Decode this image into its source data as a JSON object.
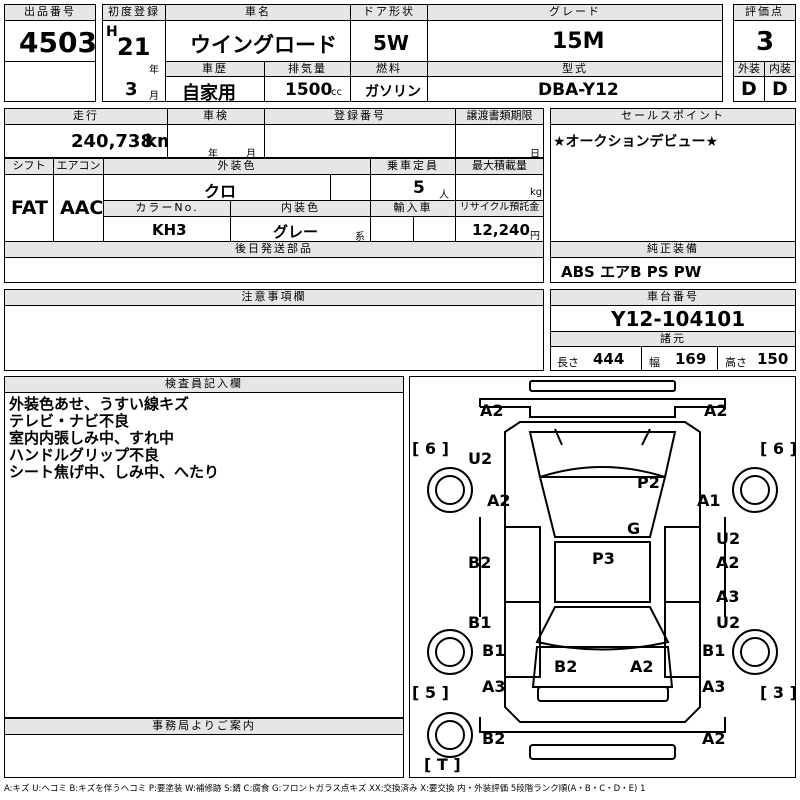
{
  "header": {
    "lot_no_label": "出品番号",
    "lot_no": "4503",
    "first_reg_label": "初度登録",
    "era": "H",
    "year": "21",
    "year_unit": "年",
    "month": "3",
    "month_unit": "月",
    "model_name_label": "車名",
    "model_name": "ウイングロード",
    "door_label": "ドア形状",
    "door": "5W",
    "grade_label": "グレード",
    "grade": "15M",
    "score_label": "評価点",
    "score": "3",
    "history_label": "車歴",
    "history": "自家用",
    "displacement_label": "排気量",
    "displacement": "1500",
    "displacement_unit": "cc",
    "fuel_label": "燃料",
    "fuel": "ガソリン",
    "type_label": "型式",
    "type": "DBA-Y12",
    "ext_grade_label": "外装",
    "ext_grade": "D",
    "int_grade_label": "内装",
    "int_grade": "D"
  },
  "row2": {
    "mileage_label": "走行",
    "mileage": "240,738",
    "mileage_unit": "km",
    "inspection_label": "車検",
    "insp_year_unit": "年",
    "insp_month_unit": "月",
    "reg_no_label": "登録番号",
    "transfer_label": "譲渡書類期限",
    "transfer_day_unit": "日",
    "sales_point_label": "セールスポイント",
    "sales_point": "★オークションデビュー★"
  },
  "row3": {
    "shift_label": "シフト",
    "shift": "FAT",
    "ac_label": "エアコン",
    "ac": "AAC",
    "ext_color_label": "外装色",
    "ext_color": "クロ",
    "capacity_label": "乗車定員",
    "capacity": "5",
    "capacity_unit": "人",
    "max_load_label": "最大積載量",
    "max_load_unit": "kg",
    "color_no_label": "カラーNo.",
    "color_no": "KH3",
    "int_color_label": "内装色",
    "int_color": "グレー",
    "int_color_suffix": "系",
    "import_label": "輸入車",
    "recycle_label": "リサイクル預託金",
    "recycle": "12,240",
    "recycle_unit": "円"
  },
  "later_parts_label": "後日発送部品",
  "equipment_label": "純正装備",
  "equipment": "ABS エアB PS PW",
  "caution_label": "注意事項欄",
  "chassis_label": "車台番号",
  "chassis": "Y12-104101",
  "specs_label": "諸元",
  "length_label": "長さ",
  "length": "444",
  "width_label": "幅",
  "width": "169",
  "height_label": "高さ",
  "height": "150",
  "inspector_label": "検査員記入欄",
  "inspector_notes": [
    "外装色あせ、うすい線キズ",
    "テレビ・ナビ不良",
    "室内内張しみ中、すれ中",
    "ハンドルグリップ不良",
    "シート焦げ中、しみ中、へたり"
  ],
  "office_label": "事務局よりご案内",
  "legend": "A:キズ U:ヘコミ B:キズを伴うヘコミ P:要塗装 W:補修跡 S:錆 C:腐食 G:フロントガラス点キズ XX:交換済み X:要交換 内・外装評価 5段階ランク順(A・B・C・D・E) 1",
  "diagram": {
    "corner_labels": [
      "[ 6 ]",
      "[ 6 ]",
      "[ 5 ]",
      "[ 3 ]",
      "[ T ]"
    ],
    "marks": [
      "A2",
      "A2",
      "U2",
      "A2",
      "P2",
      "A1",
      "G",
      "U2",
      "B2",
      "P3",
      "A2",
      "A3",
      "B1",
      "U2",
      "B1",
      "B1",
      "B2",
      "A2",
      "A3",
      "A3",
      "B2",
      "A2"
    ]
  }
}
